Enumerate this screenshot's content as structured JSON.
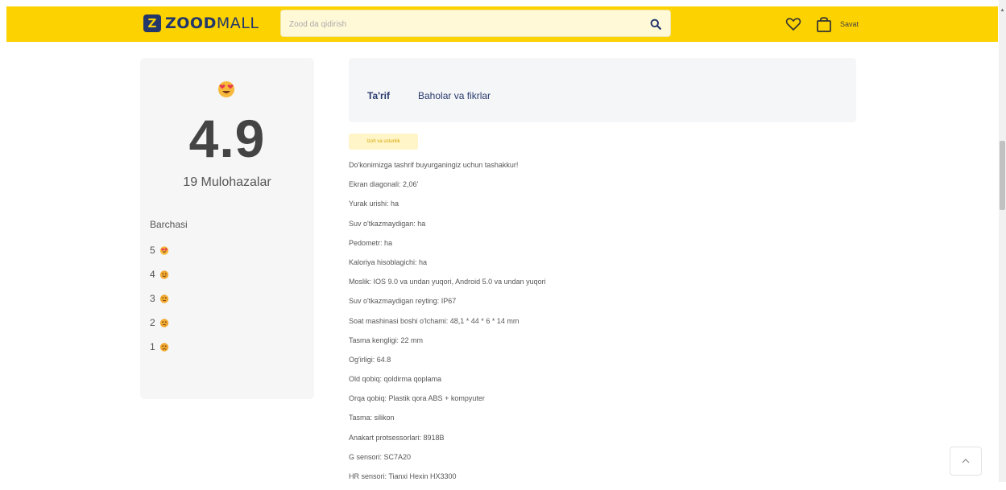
{
  "header": {
    "logo_mark": "Z",
    "logo_bold": "ZOOD",
    "logo_light": "MALL",
    "search_placeholder": "Zood da qidirish",
    "cart_label": "Savat",
    "accent_color": "#fcd200",
    "brand_color": "#23376b"
  },
  "rating": {
    "score": "4.9",
    "reviews_label": "19 Mulohazalar",
    "all_label": "Barchasi",
    "levels": [
      {
        "stars": "5",
        "icon": "heart-eyes-emoji"
      },
      {
        "stars": "4",
        "icon": "smile-emoji"
      },
      {
        "stars": "3",
        "icon": "neutral-emoji"
      },
      {
        "stars": "2",
        "icon": "frown-emoji"
      },
      {
        "stars": "1",
        "icon": "sad-emoji"
      }
    ]
  },
  "tabs": {
    "description": "Ta'rif",
    "reviews": "Baholar va fikrlar"
  },
  "chip_label": "Izoh va ustunlik",
  "specs": [
    "Do'konimizga tashrif buyurganingiz uchun tashakkur!",
    "Ekran diagonali: 2,06'",
    "Yurak urishi: ha",
    "Suv o'tkazmaydigan: ha",
    "Pedometr: ha",
    "Kaloriya hisoblagichi: ha",
    "Moslik: IOS 9.0 va undan yuqori, Android 5.0 va undan yuqori",
    "Suv o'tkazmaydigan reyting: IP67",
    "Soat mashinasi boshi o'lchami: 48,1 * 44 * 6 * 14 mm",
    "Tasma kengligi: 22 mm",
    "Og'irligi: 64.8",
    "Old qobiq: qoldirma qoplama",
    "Orqa qobiq: Plastik qora ABS + kompyuter",
    "Tasma: silikon",
    "Anakart protsessorlari: 8918B",
    "G sensori: SC7A20",
    "HR sensori: Tianxi Hexin HX3300"
  ]
}
